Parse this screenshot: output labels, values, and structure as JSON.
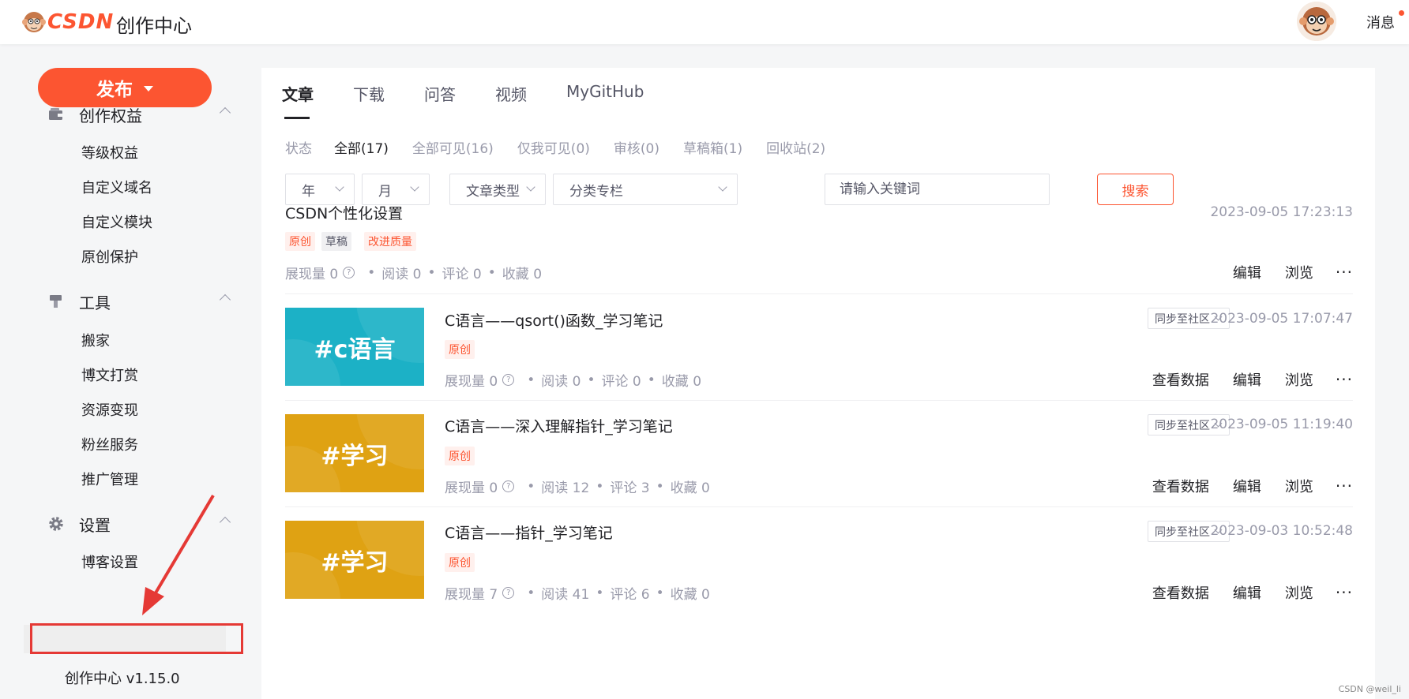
{
  "header": {
    "logo_text": "CSDN",
    "app_title": "创作中心",
    "messages_label": "消息"
  },
  "sidebar": {
    "publish_label": "发布",
    "sections": [
      {
        "label": "创作权益",
        "icon": "wallet-icon",
        "items": [
          "等级权益",
          "自定义域名",
          "自定义模块",
          "原创保护"
        ]
      },
      {
        "label": "工具",
        "icon": "tool-icon",
        "items": [
          "搬家",
          "博文打赏",
          "资源变现",
          "粉丝服务",
          "推广管理"
        ]
      },
      {
        "label": "设置",
        "icon": "gear-icon",
        "items": [
          "博客设置"
        ]
      }
    ],
    "version": "创作中心 v1.15.0"
  },
  "main": {
    "tabs": [
      "文章",
      "下载",
      "问答",
      "视频",
      "MyGitHub"
    ],
    "status": {
      "label": "状态",
      "options": [
        "全部(17)",
        "全部可见(16)",
        "仅我可见(0)",
        "审核(0)",
        "草稿箱(1)",
        "回收站(2)"
      ]
    },
    "filters": {
      "year": "年",
      "month": "月",
      "type": "文章类型",
      "category": "分类专栏",
      "keyword_placeholder": "请输入关键词",
      "search_label": "搜索"
    },
    "articles": [
      {
        "title": "CSDN个性化设置",
        "time": "2023-09-05 17:23:13",
        "tags": {
          "orig": "原创",
          "draft": "草稿",
          "improve": "改进质量"
        },
        "stats": {
          "views": "展现量 0",
          "reads": "阅读 0",
          "comments": "评论 0",
          "favs": "收藏 0"
        },
        "actions": {
          "edit": "编辑",
          "browse": "浏览",
          "more": "···"
        }
      },
      {
        "title": "C语言——qsort()函数_学习笔记",
        "time": "2023-09-05 17:07:47",
        "thumb_text": "#c语言",
        "thumb_color": "#1cb1c6",
        "sync_label": "同步至社区",
        "tag": "原创",
        "stats": {
          "views": "展现量 0",
          "reads": "阅读 0",
          "comments": "评论 0",
          "favs": "收藏 0"
        },
        "actions": {
          "data": "查看数据",
          "edit": "编辑",
          "browse": "浏览",
          "more": "···"
        }
      },
      {
        "title": "C语言——深入理解指针_学习笔记",
        "time": "2023-09-05 11:19:40",
        "thumb_text": "#学习",
        "thumb_color": "#dfa213",
        "sync_label": "同步至社区",
        "tag": "原创",
        "stats": {
          "views": "展现量 0",
          "reads": "阅读 12",
          "comments": "评论 3",
          "favs": "收藏 0"
        },
        "actions": {
          "data": "查看数据",
          "edit": "编辑",
          "browse": "浏览",
          "more": "···"
        }
      },
      {
        "title": "C语言——指针_学习笔记",
        "time": "2023-09-03 10:52:48",
        "thumb_text": "#学习",
        "thumb_color": "#dfa213",
        "sync_label": "同步至社区",
        "tag": "原创",
        "stats": {
          "views": "展现量 7",
          "reads": "阅读 41",
          "comments": "评论 6",
          "favs": "收藏 0"
        },
        "actions": {
          "data": "查看数据",
          "edit": "编辑",
          "browse": "浏览",
          "more": "···"
        }
      }
    ]
  },
  "watermark": "CSDN @weil_li",
  "colors": {
    "accent": "#fc5531",
    "annotation": "#e53935"
  }
}
